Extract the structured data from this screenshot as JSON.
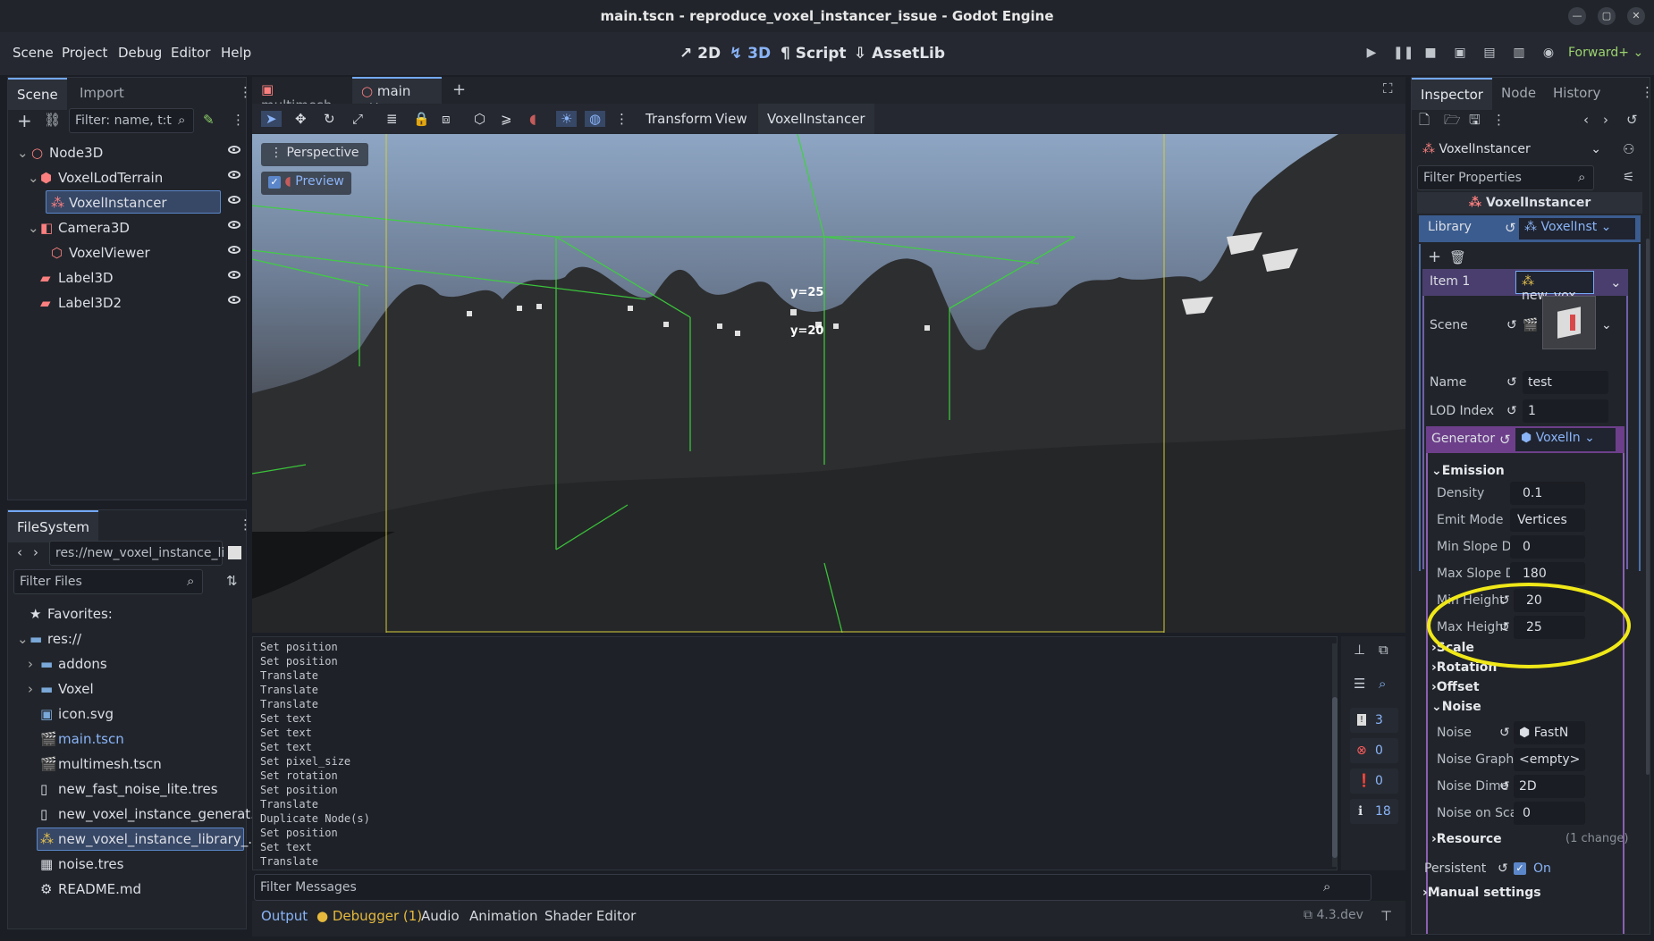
{
  "window": {
    "title": "main.tscn - reproduce_voxel_instancer_issue - Godot Engine"
  },
  "menu": [
    "Scene",
    "Project",
    "Debug",
    "Editor",
    "Help"
  ],
  "workspaces": [
    {
      "label": "2D",
      "icon": "2d-icon"
    },
    {
      "label": "3D",
      "icon": "3d-icon"
    },
    {
      "label": "Script",
      "icon": "script-icon"
    },
    {
      "label": "AssetLib",
      "icon": "assetlib-icon"
    }
  ],
  "renderer": "Forward+",
  "scene_dock": {
    "tabs": [
      "Scene",
      "Import"
    ],
    "filter_placeholder": "Filter: name, t:t",
    "nodes": [
      {
        "name": "Node3D",
        "icon": "node3d-icon",
        "color": "#fc7f7f"
      },
      {
        "name": "VoxelLodTerrain",
        "icon": "voxel-terrain-icon",
        "color": "#fc7f7f"
      },
      {
        "name": "VoxelInstancer",
        "icon": "voxel-instancer-icon",
        "color": "#fc7f7f"
      },
      {
        "name": "Camera3D",
        "icon": "camera3d-icon",
        "color": "#fc7f7f"
      },
      {
        "name": "VoxelViewer",
        "icon": "voxel-viewer-icon",
        "color": "#fc7f7f"
      },
      {
        "name": "Label3D",
        "icon": "label3d-icon",
        "color": "#fc7f7f"
      },
      {
        "name": "Label3D2",
        "icon": "label3d-icon",
        "color": "#fc7f7f"
      }
    ]
  },
  "filesystem": {
    "tab": "FileSystem",
    "path": "res://new_voxel_instance_li",
    "filter_placeholder": "Filter Files",
    "favorites": "Favorites:",
    "root": "res://",
    "items": [
      "addons",
      "Voxel",
      "icon.svg",
      "main.tscn",
      "multimesh.tscn",
      "new_fast_noise_lite.tres",
      "new_voxel_instance_generat...",
      "new_voxel_instance_library_...",
      "noise.tres",
      "README.md"
    ]
  },
  "editor_tabs": [
    "multimesh",
    "main"
  ],
  "viewport_toolbar": {
    "menus": [
      "Transform",
      "View",
      "VoxelInstancer"
    ]
  },
  "viewport": {
    "perspective": "Perspective",
    "preview": "Preview",
    "labels": [
      "y=25",
      "y=20"
    ]
  },
  "output": {
    "lines": [
      "Set position",
      "Set position",
      "Translate",
      "Translate",
      "Translate",
      "Set text",
      "Set text",
      "Set text",
      "Set pixel_size",
      "Set rotation",
      "Set position",
      "Translate",
      "Duplicate Node(s)",
      "Set position",
      "Set text",
      "Translate"
    ],
    "filter_placeholder": "Filter Messages",
    "counts": {
      "messages": "3",
      "errors": "0",
      "warnings": "0",
      "info": "18"
    }
  },
  "bottom_tabs": [
    "Output",
    "Debugger (1)",
    "Audio",
    "Animation",
    "Shader Editor"
  ],
  "version": "4.3.dev",
  "inspector": {
    "tabs": [
      "Inspector",
      "Node",
      "History"
    ],
    "object": "VoxelInstancer",
    "filter_placeholder": "Filter Properties",
    "header": "VoxelInstancer",
    "library_label": "Library",
    "library_value": "VoxelInst",
    "item_label": "Item 1",
    "item_value": "new_vox",
    "scene_label": "Scene",
    "name_label": "Name",
    "name_value": "test",
    "lod_label": "LOD Index",
    "lod_value": "1",
    "generator_label": "Generator",
    "generator_value": "VoxelIn",
    "emission": "Emission",
    "density_label": "Density",
    "density_value": "0.1",
    "emit_mode_label": "Emit Mode",
    "emit_mode_value": "Vertices",
    "min_slope_label": "Min Slope De",
    "min_slope_value": "0",
    "max_slope_label": "Max Slope De",
    "max_slope_value": "180",
    "min_height_label": "Min Height",
    "min_height_value": "20",
    "max_height_label": "Max Height",
    "max_height_value": "25",
    "scale": "Scale",
    "rotation": "Rotation",
    "offset": "Offset",
    "noise": "Noise",
    "noise_label": "Noise",
    "noise_value": "FastN",
    "noise_graph_label": "Noise Graph",
    "noise_graph_value": "<empty>",
    "noise_dim_label": "Noise Dime",
    "noise_dim_value": "2D",
    "noise_scale_label": "Noise on Scal",
    "noise_scale_value": "0",
    "resource": "Resource",
    "resource_change": "(1 change)",
    "persistent_label": "Persistent",
    "persistent_value": "On",
    "manual": "Manual settings"
  },
  "colors": {
    "accent": "#74a8f5",
    "highlight": "#f0e818",
    "green_lines": "#3cd43c"
  }
}
